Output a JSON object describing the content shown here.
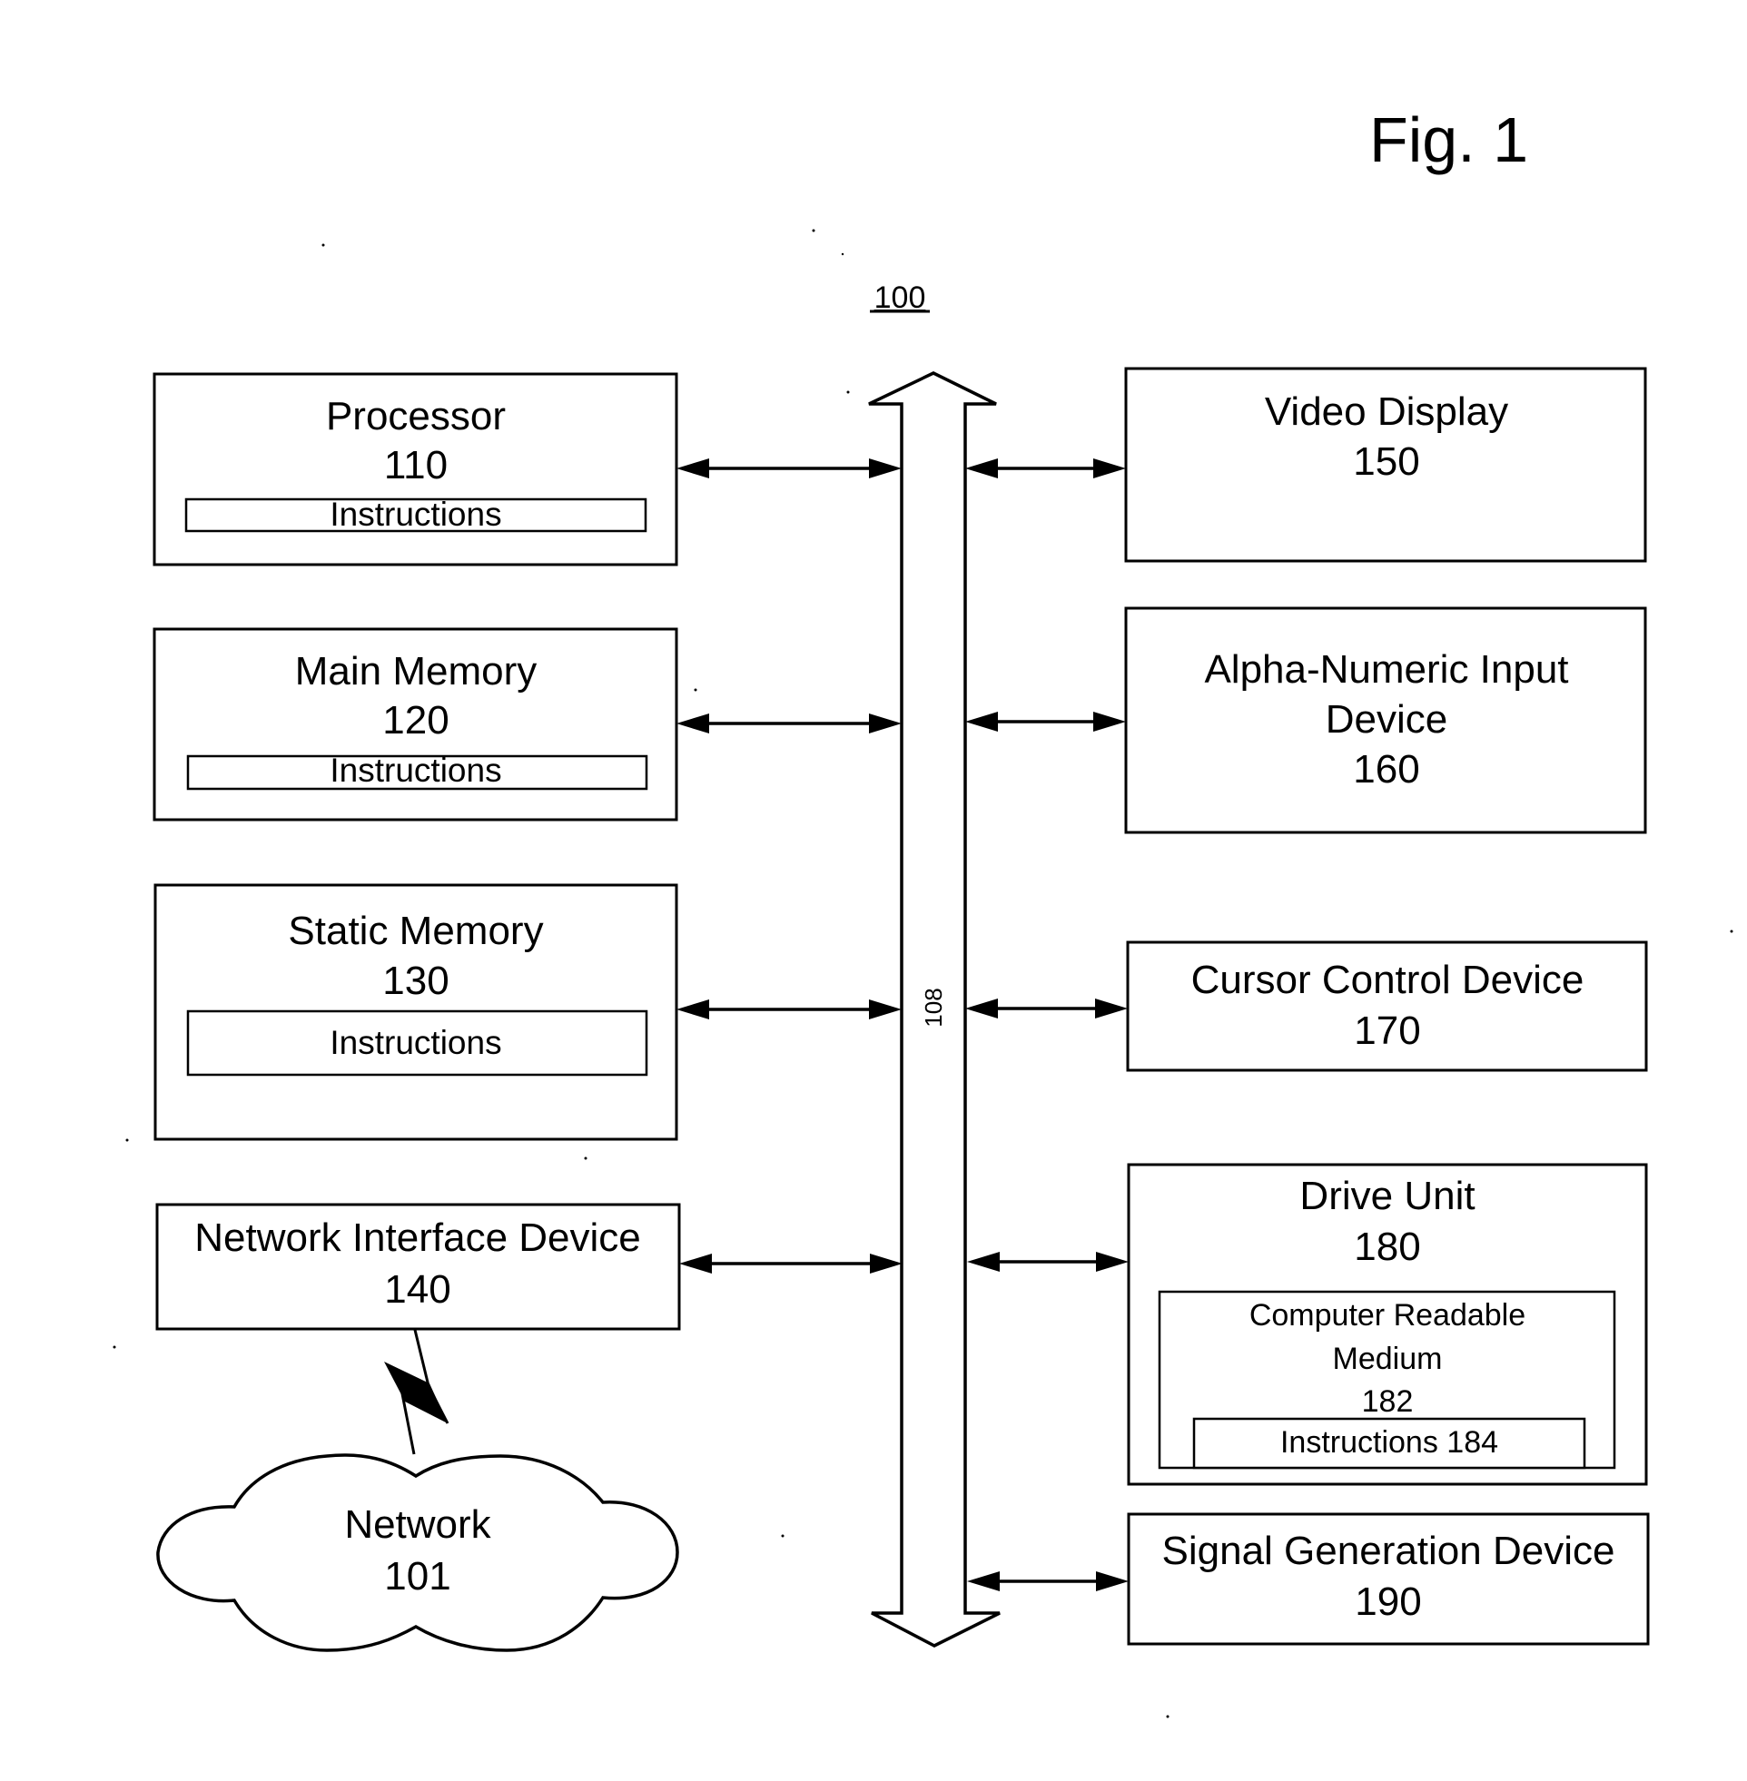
{
  "figure": {
    "title": "Fig. 1",
    "system_ref": "100",
    "bus_ref": "108"
  },
  "components": {
    "processor": {
      "name": "Processor",
      "ref": "110",
      "instructions": "Instructions"
    },
    "main_memory": {
      "name": "Main Memory",
      "ref": "120",
      "instructions": "Instructions"
    },
    "static_memory": {
      "name": "Static Memory",
      "ref": "130",
      "instructions": "Instructions"
    },
    "network_interface": {
      "name": "Network Interface Device",
      "ref": "140"
    },
    "network": {
      "name": "Network",
      "ref": "101"
    },
    "video_display": {
      "name": "Video Display",
      "ref": "150"
    },
    "alpha_numeric_input": {
      "name_line1": "Alpha-Numeric Input",
      "name_line2": "Device",
      "ref": "160"
    },
    "cursor_control": {
      "name": "Cursor Control Device",
      "ref": "170"
    },
    "drive_unit": {
      "name": "Drive Unit",
      "ref": "180",
      "medium": {
        "name_line1": "Computer Readable",
        "name_line2": "Medium",
        "ref": "182"
      },
      "instructions": "Instructions 184"
    },
    "signal_generation": {
      "name": "Signal Generation Device",
      "ref": "190"
    }
  },
  "connections": [
    {
      "from": "processor",
      "to": "bus",
      "type": "bidirectional"
    },
    {
      "from": "main_memory",
      "to": "bus",
      "type": "bidirectional"
    },
    {
      "from": "static_memory",
      "to": "bus",
      "type": "bidirectional"
    },
    {
      "from": "network_interface",
      "to": "bus",
      "type": "bidirectional"
    },
    {
      "from": "video_display",
      "to": "bus",
      "type": "bidirectional"
    },
    {
      "from": "alpha_numeric_input",
      "to": "bus",
      "type": "bidirectional"
    },
    {
      "from": "cursor_control",
      "to": "bus",
      "type": "bidirectional"
    },
    {
      "from": "drive_unit",
      "to": "bus",
      "type": "bidirectional"
    },
    {
      "from": "signal_generation",
      "to": "bus",
      "type": "bidirectional"
    },
    {
      "from": "network_interface",
      "to": "network",
      "type": "wireless"
    }
  ]
}
